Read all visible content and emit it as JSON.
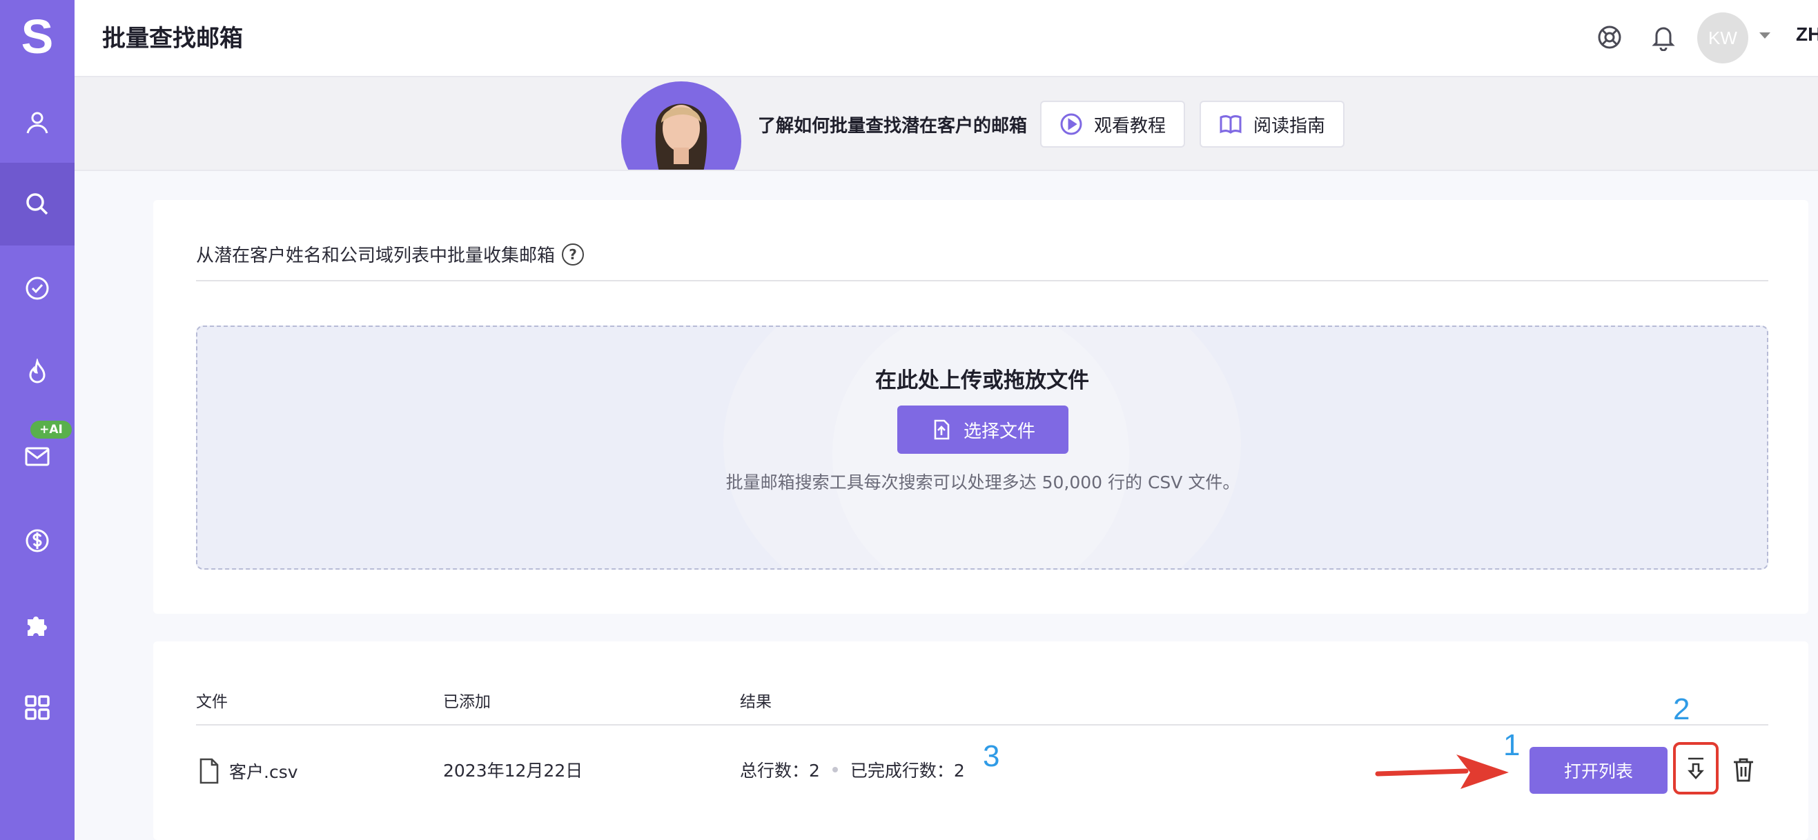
{
  "app": {
    "logo_letter": "S"
  },
  "sidebar": {
    "items": [
      {
        "name": "contacts",
        "icon": "user-icon"
      },
      {
        "name": "search",
        "icon": "search-icon",
        "active": true
      },
      {
        "name": "verify",
        "icon": "check-circle-icon"
      },
      {
        "name": "warmup",
        "icon": "flame-icon"
      },
      {
        "name": "email",
        "icon": "mail-icon",
        "badge": "+AI"
      },
      {
        "name": "pricing",
        "icon": "dollar-icon"
      },
      {
        "name": "extensions",
        "icon": "puzzle-icon"
      },
      {
        "name": "apps",
        "icon": "grid-icon"
      }
    ]
  },
  "header": {
    "title": "批量查找邮箱",
    "avatar_initials": "KW",
    "language": "ZH"
  },
  "banner": {
    "text": "了解如何批量查找潜在客户的邮箱",
    "watch_label": "观看教程",
    "read_label": "阅读指南"
  },
  "upload": {
    "section_title": "从潜在客户姓名和公司域列表中批量收集邮箱",
    "help_glyph": "?",
    "drop_title": "在此处上传或拖放文件",
    "select_button": "选择文件",
    "description": "批量邮箱搜索工具每次搜索可以处理多达 50,000 行的 CSV 文件。"
  },
  "files": {
    "columns": {
      "file": "文件",
      "added": "已添加",
      "result": "结果"
    },
    "rows": [
      {
        "file_name": "客户.csv",
        "added": "2023年12月22日",
        "total_rows": "总行数：2",
        "done_rows": "已完成行数：2",
        "open_label": "打开列表"
      }
    ]
  },
  "annotations": {
    "one": "1",
    "two": "2",
    "three": "3"
  },
  "colors": {
    "accent": "#7f69e3",
    "highlight": "#e23b30",
    "annotation": "#2f9be6",
    "badge": "#59b04c"
  }
}
